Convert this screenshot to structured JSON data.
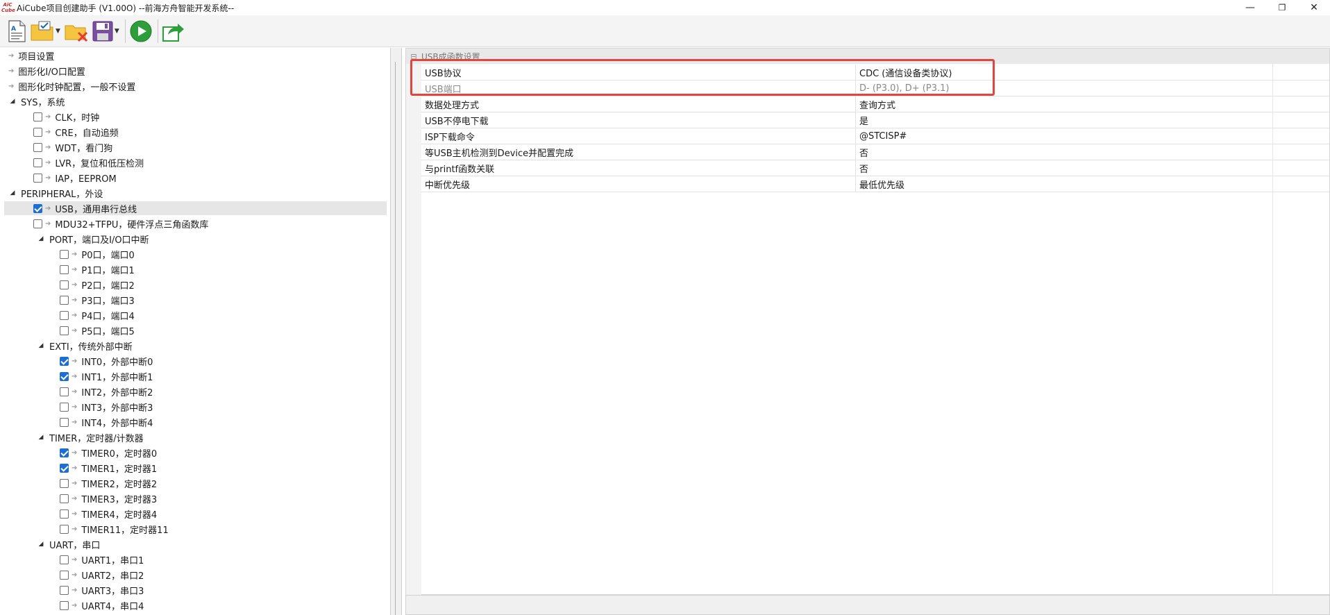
{
  "window": {
    "title": "AiCube项目创建助手 (V1.00O) --前海方舟智能开发系统--",
    "logo_text": "AiC Cube",
    "controls": {
      "minimize": "—",
      "maximize": "❐",
      "close": "✕"
    }
  },
  "toolbar": {
    "buttons": [
      {
        "icon": "new-project-icon",
        "has_dropdown": false
      },
      {
        "icon": "open-project-icon",
        "has_dropdown": true
      },
      {
        "icon": "close-project-icon",
        "has_dropdown": false
      },
      {
        "icon": "save-icon",
        "has_dropdown": true
      },
      {
        "icon": "run-icon",
        "has_dropdown": false
      },
      {
        "icon": "export-icon",
        "has_dropdown": false
      }
    ]
  },
  "tree": {
    "items": [
      {
        "label": "项目设置",
        "level": 0,
        "type": "leaf"
      },
      {
        "label": "图形化I/O口配置",
        "level": 0,
        "type": "leaf"
      },
      {
        "label": "图形化时钟配置，一般不设置",
        "level": 0,
        "type": "leaf"
      },
      {
        "label": "SYS，系统",
        "level": 0,
        "type": "group"
      },
      {
        "label": "CLK，时钟",
        "level": 1,
        "type": "check",
        "checked": false
      },
      {
        "label": "CRE，自动追频",
        "level": 1,
        "type": "check",
        "checked": false
      },
      {
        "label": "WDT，看门狗",
        "level": 1,
        "type": "check",
        "checked": false
      },
      {
        "label": "LVR，复位和低压检测",
        "level": 1,
        "type": "check",
        "checked": false
      },
      {
        "label": "IAP，EEPROM",
        "level": 1,
        "type": "check",
        "checked": false
      },
      {
        "label": "PERIPHERAL，外设",
        "level": 0,
        "type": "group"
      },
      {
        "label": "USB，通用串行总线",
        "level": 1,
        "type": "check",
        "checked": true,
        "selected": true
      },
      {
        "label": "MDU32+TFPU，硬件浮点三角函数库",
        "level": 1,
        "type": "check",
        "checked": false
      },
      {
        "label": "PORT，端口及I/O口中断",
        "level": 1,
        "type": "group"
      },
      {
        "label": "P0口，端口0",
        "level": 2,
        "type": "check",
        "checked": false
      },
      {
        "label": "P1口，端口1",
        "level": 2,
        "type": "check",
        "checked": false
      },
      {
        "label": "P2口，端口2",
        "level": 2,
        "type": "check",
        "checked": false
      },
      {
        "label": "P3口，端口3",
        "level": 2,
        "type": "check",
        "checked": false
      },
      {
        "label": "P4口，端口4",
        "level": 2,
        "type": "check",
        "checked": false
      },
      {
        "label": "P5口，端口5",
        "level": 2,
        "type": "check",
        "checked": false
      },
      {
        "label": "EXTI，传统外部中断",
        "level": 1,
        "type": "group"
      },
      {
        "label": "INT0，外部中断0",
        "level": 2,
        "type": "check",
        "checked": true
      },
      {
        "label": "INT1，外部中断1",
        "level": 2,
        "type": "check",
        "checked": true
      },
      {
        "label": "INT2，外部中断2",
        "level": 2,
        "type": "check",
        "checked": false
      },
      {
        "label": "INT3，外部中断3",
        "level": 2,
        "type": "check",
        "checked": false
      },
      {
        "label": "INT4，外部中断4",
        "level": 2,
        "type": "check",
        "checked": false
      },
      {
        "label": "TIMER，定时器/计数器",
        "level": 1,
        "type": "group"
      },
      {
        "label": "TIMER0，定时器0",
        "level": 2,
        "type": "check",
        "checked": true
      },
      {
        "label": "TIMER1，定时器1",
        "level": 2,
        "type": "check",
        "checked": true
      },
      {
        "label": "TIMER2，定时器2",
        "level": 2,
        "type": "check",
        "checked": false
      },
      {
        "label": "TIMER3，定时器3",
        "level": 2,
        "type": "check",
        "checked": false
      },
      {
        "label": "TIMER4，定时器4",
        "level": 2,
        "type": "check",
        "checked": false
      },
      {
        "label": "TIMER11，定时器11",
        "level": 2,
        "type": "check",
        "checked": false
      },
      {
        "label": "UART，串口",
        "level": 1,
        "type": "group"
      },
      {
        "label": "UART1，串口1",
        "level": 2,
        "type": "check",
        "checked": false
      },
      {
        "label": "UART2，串口2",
        "level": 2,
        "type": "check",
        "checked": false
      },
      {
        "label": "UART3，串口3",
        "level": 2,
        "type": "check",
        "checked": false
      },
      {
        "label": "UART4，串口4",
        "level": 2,
        "type": "check",
        "checked": false
      }
    ]
  },
  "property_grid": {
    "category": "USB成函数设置",
    "rows": [
      {
        "name": "USB协议",
        "value": "CDC (通信设备类协议)",
        "disabled": false
      },
      {
        "name": "USB端口",
        "value": "D- (P3.0), D+ (P3.1)",
        "disabled": true
      },
      {
        "name": "数据处理方式",
        "value": "查询方式",
        "disabled": false
      },
      {
        "name": "USB不停电下载",
        "value": "是",
        "disabled": false
      },
      {
        "name": "ISP下载命令",
        "value": "@STCISP#",
        "disabled": false
      },
      {
        "name": "等USB主机检测到Device并配置完成",
        "value": "否",
        "disabled": false
      },
      {
        "name": "与printf函数关联",
        "value": "否",
        "disabled": false
      },
      {
        "name": "中断优先级",
        "value": "最低优先级",
        "disabled": false
      }
    ]
  },
  "colors": {
    "highlight": "#e0453e",
    "checkbox_checked": "#1c6fd1",
    "selected_row": "#e6e6e6"
  }
}
